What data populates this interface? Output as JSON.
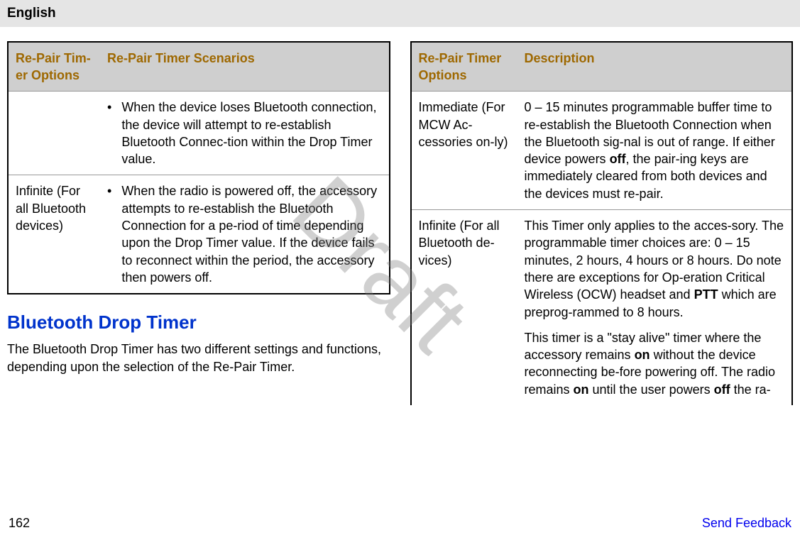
{
  "header": {
    "language": "English"
  },
  "watermark": "Draft",
  "left": {
    "headers": {
      "options": "Re-Pair Tim-er Options",
      "scenarios": "Re-Pair Timer Scenarios"
    },
    "rows": [
      {
        "option": "",
        "bullet": "•",
        "scenario": "When the device loses Bluetooth connection, the device will attempt to re-establish Bluetooth Connec-tion within the Drop Timer value."
      },
      {
        "option": "Infinite (For all Bluetooth devices)",
        "bullet": "•",
        "scenario": "When the radio is powered off, the accessory attempts to re-establish the Bluetooth Connection for a pe-riod of time depending upon the Drop Timer value. If the device fails to reconnect within the period, the accessory then powers off."
      }
    ],
    "section": {
      "title": "Bluetooth Drop Timer",
      "desc": "The Bluetooth Drop Timer has two different settings and functions, depending upon the selection of the Re-Pair Timer."
    }
  },
  "right": {
    "headers": {
      "options": "Re-Pair Timer Options",
      "description": "Description"
    },
    "rows": [
      {
        "option": "Immediate (For MCW Ac-cessories on-ly)",
        "desc_pre": "0 – 15 minutes programmable buffer time to re-establish the Bluetooth Connection when the Bluetooth sig-nal is out of range.\nIf either device powers ",
        "bold1": "off",
        "desc_post": ", the pair-ing keys are immediately cleared from both devices and the devices must re-pair."
      },
      {
        "option": "Infinite (For all Bluetooth de-vices)",
        "p1_pre": "This Timer only applies to the acces-sory. The programmable timer choices are: 0 – 15 minutes, 2 hours, 4 hours or 8 hours.\nDo note there are exceptions for Op-eration Critical Wireless (OCW) headset and ",
        "p1_bold": "PTT",
        "p1_post": " which are preprog-rammed to 8 hours.",
        "p2_pre": "This timer is a \"stay alive\" timer where the accessory remains ",
        "p2_bold1": "on",
        "p2_mid": " without the device reconnecting be-fore powering off. The radio remains ",
        "p2_bold2": "on",
        "p2_mid2": " until the user powers ",
        "p2_bold3": "off",
        "p2_post": " the ra-"
      }
    ]
  },
  "footer": {
    "page": "162",
    "feedback": "Send Feedback"
  }
}
